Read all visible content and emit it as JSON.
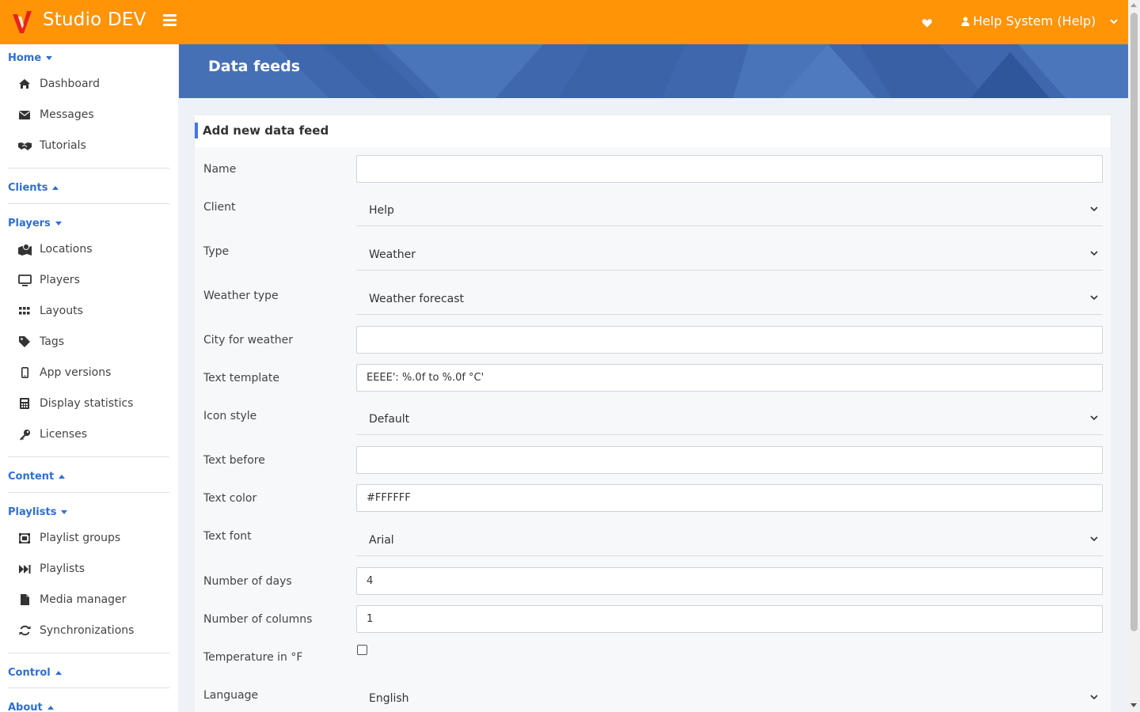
{
  "app": {
    "title": "Studio DEV"
  },
  "topbar": {
    "user_label": "Help System (Help)"
  },
  "sidebar": {
    "sections": {
      "home": "Home",
      "clients": "Clients",
      "players": "Players",
      "content": "Content",
      "playlists": "Playlists",
      "control": "Control",
      "about": "About"
    },
    "home_items": [
      "Dashboard",
      "Messages",
      "Tutorials"
    ],
    "player_items": [
      "Locations",
      "Players",
      "Layouts",
      "Tags",
      "App versions",
      "Display statistics",
      "Licenses"
    ],
    "playlist_items": [
      "Playlist groups",
      "Playlists",
      "Media manager",
      "Synchronizations"
    ]
  },
  "page": {
    "title": "Data feeds"
  },
  "form": {
    "title": "Add new data feed",
    "labels": {
      "name": "Name",
      "client": "Client",
      "type": "Type",
      "weather_type": "Weather type",
      "city": "City for weather",
      "text_template": "Text template",
      "icon_style": "Icon style",
      "text_before": "Text before",
      "text_color": "Text color",
      "text_font": "Text font",
      "num_days": "Number of days",
      "num_columns": "Number of columns",
      "temp_f": "Temperature in °F",
      "language": "Language"
    },
    "values": {
      "name": "",
      "client": "Help",
      "type": "Weather",
      "weather_type": "Weather forecast",
      "city": "",
      "text_template": "EEEE': %.0f to %.0f °C'",
      "icon_style": "Default",
      "text_before": "",
      "text_color": "#FFFFFF",
      "text_font": "Arial",
      "num_days": "4",
      "num_columns": "1",
      "temp_f": false,
      "language": "English"
    }
  },
  "colors": {
    "topbar": "#ff9407",
    "banner": "#3e67ad",
    "link": "#2f6fd1",
    "accent": "#3b78e7"
  }
}
